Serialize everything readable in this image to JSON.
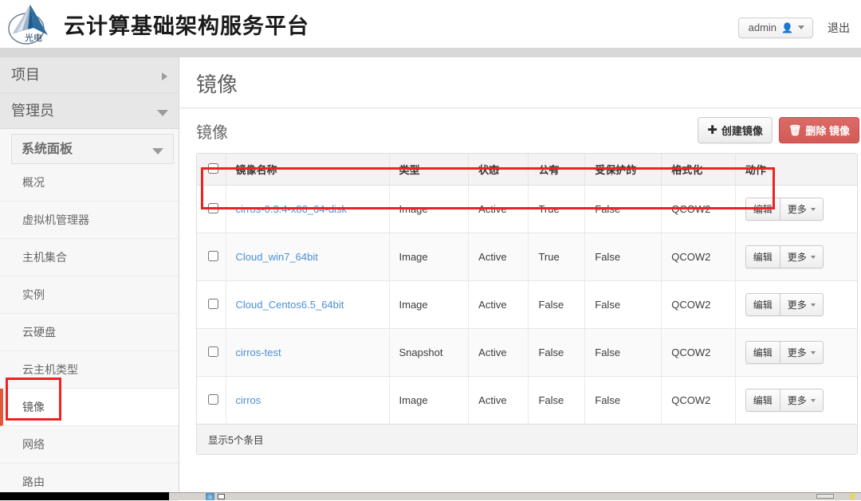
{
  "header": {
    "brand_title": "云计算基础架构服务平台",
    "logo_text": "光电",
    "user_label": "admin",
    "logout_label": "退出"
  },
  "sidebar": {
    "groups": [
      {
        "label": "项目",
        "icon": "chevron-right-icon"
      },
      {
        "label": "管理员",
        "icon": "chevron-down-icon"
      }
    ],
    "panel_label": "系统面板",
    "items": [
      {
        "label": "概况",
        "active": false
      },
      {
        "label": "虚拟机管理器",
        "active": false
      },
      {
        "label": "主机集合",
        "active": false
      },
      {
        "label": "实例",
        "active": false
      },
      {
        "label": "云硬盘",
        "active": false
      },
      {
        "label": "云主机类型",
        "active": false
      },
      {
        "label": "镜像",
        "active": true
      },
      {
        "label": "网络",
        "active": false
      },
      {
        "label": "路由",
        "active": false
      }
    ]
  },
  "main": {
    "page_title": "镜像",
    "panel_title": "镜像",
    "create_button": "创建镜像",
    "delete_button": "删除 镜像",
    "create_icon": "plus-icon",
    "delete_icon": "trash-icon",
    "table": {
      "columns": [
        "镜像名称",
        "类型",
        "状态",
        "公有",
        "受保护的",
        "格式化",
        "动作"
      ],
      "rows": [
        {
          "name": "cirros-0.3.4-x86_64-disk",
          "type": "Image",
          "status": "Active",
          "public": "True",
          "protected": "False",
          "format": "QCOW2",
          "edit": "编辑",
          "more": "更多"
        },
        {
          "name": "Cloud_win7_64bit",
          "type": "Image",
          "status": "Active",
          "public": "True",
          "protected": "False",
          "format": "QCOW2",
          "edit": "编辑",
          "more": "更多"
        },
        {
          "name": "Cloud_Centos6.5_64bit",
          "type": "Image",
          "status": "Active",
          "public": "False",
          "protected": "False",
          "format": "QCOW2",
          "edit": "编辑",
          "more": "更多"
        },
        {
          "name": "cirros-test",
          "type": "Snapshot",
          "status": "Active",
          "public": "False",
          "protected": "False",
          "format": "QCOW2",
          "edit": "编辑",
          "more": "更多"
        },
        {
          "name": "cirros",
          "type": "Image",
          "status": "Active",
          "public": "False",
          "protected": "False",
          "format": "QCOW2",
          "edit": "编辑",
          "more": "更多"
        }
      ],
      "footer": "显示5个条目"
    }
  },
  "annotations": {
    "highlight_color": "#ee2222",
    "sidebar_target": "镜像",
    "row_target": "cirros-0.3.4-x86_64-disk"
  },
  "colors": {
    "accent_link": "#4a90d9",
    "danger": "#d9534f",
    "active_marker": "#e05a3a"
  }
}
